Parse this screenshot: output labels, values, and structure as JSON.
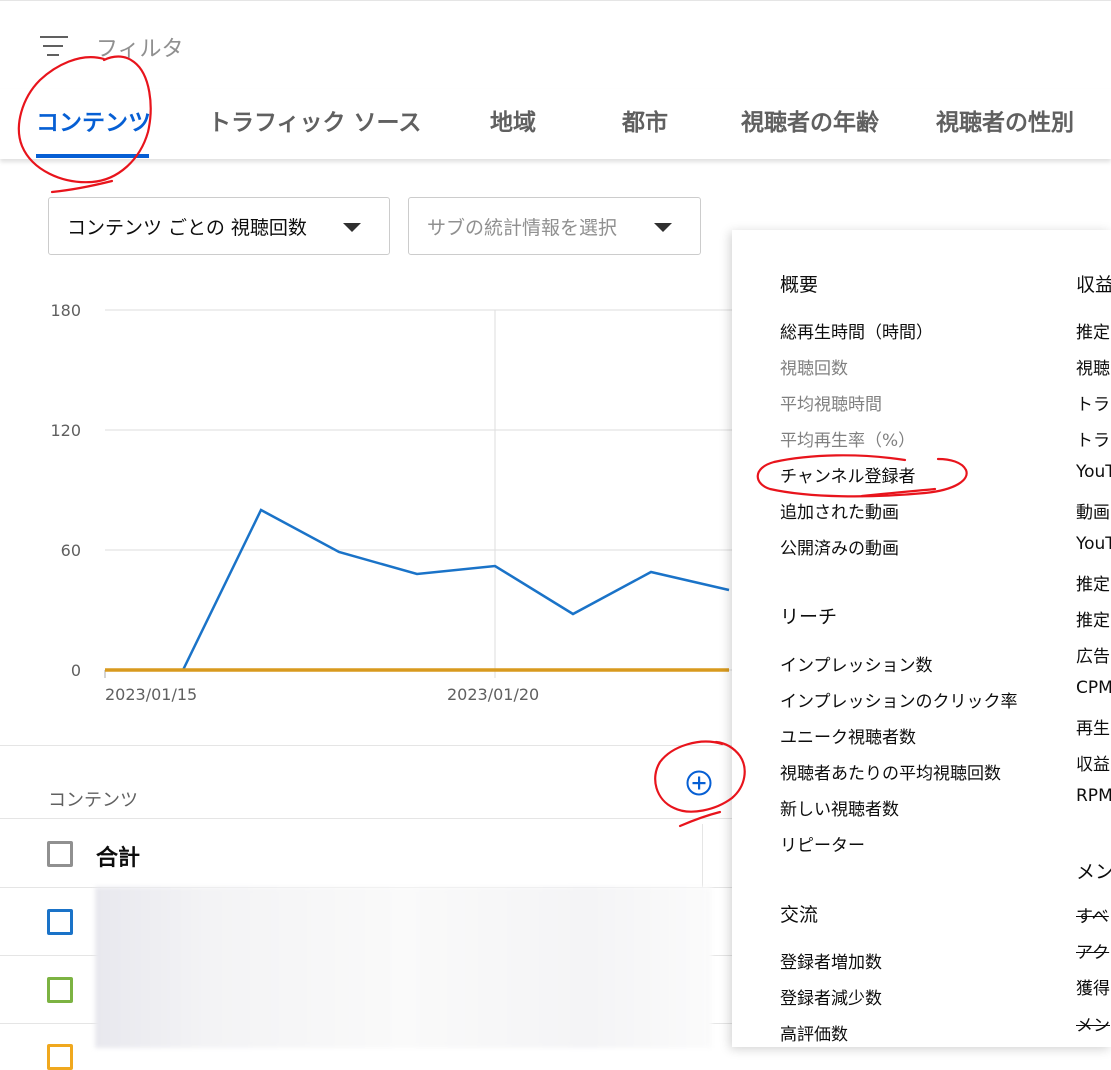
{
  "filter": {
    "label": "フィルタ",
    "icon": "filter-lines-icon"
  },
  "tabs": [
    {
      "label": "コンテンツ",
      "active": true
    },
    {
      "label": "トラフィック ソース"
    },
    {
      "label": "地域"
    },
    {
      "label": "都市"
    },
    {
      "label": "視聴者の年齢"
    },
    {
      "label": "視聴者の性別"
    }
  ],
  "dropdowns": {
    "metric": "コンテンツ ごとの 視聴回数",
    "sub_metric_placeholder": "サブの統計情報を選択"
  },
  "chart_data": {
    "type": "line",
    "y_ticks": [
      180,
      120,
      60,
      0
    ],
    "x_tick_labels": [
      "2023/01/15",
      "2023/01/20"
    ],
    "ylim": [
      0,
      180
    ],
    "grid": true,
    "x": [
      "2023/01/14",
      "2023/01/15",
      "2023/01/16",
      "2023/01/17",
      "2023/01/18",
      "2023/01/19",
      "2023/01/20",
      "2023/01/21",
      "2023/01/22",
      "2023/01/23"
    ],
    "series": [
      {
        "color": "#1a73c8",
        "values": [
          0,
          0,
          0,
          80,
          59,
          48,
          52,
          28,
          49,
          40
        ]
      },
      {
        "color": "#d89a1e",
        "values": [
          0,
          0,
          0,
          0,
          0,
          0,
          0,
          0,
          0,
          0
        ]
      }
    ]
  },
  "content_table": {
    "header": "コンテンツ",
    "add_column_icon": "add-circle-icon",
    "total_label": "合計",
    "row_colors": [
      "#1a73c8",
      "#7cb342",
      "#f0a81e"
    ]
  },
  "metric_menu": {
    "col1": [
      {
        "section": "概要",
        "items": [
          {
            "label": "総再生時間（時間）"
          },
          {
            "label": "視聴回数",
            "dim": true
          },
          {
            "label": "平均視聴時間",
            "dim": true
          },
          {
            "label": "平均再生率（%）",
            "dim": true
          },
          {
            "label": "チャンネル登録者"
          },
          {
            "label": "追加された動画"
          },
          {
            "label": "公開済みの動画"
          }
        ]
      },
      {
        "section": "リーチ",
        "items": [
          {
            "label": "インプレッション数"
          },
          {
            "label": "インプレッションのクリック率"
          },
          {
            "label": "ユニーク視聴者数"
          },
          {
            "label": "視聴者あたりの平均視聴回数"
          },
          {
            "label": "新しい視聴者数"
          },
          {
            "label": "リピーター"
          }
        ]
      },
      {
        "section": "交流",
        "items": [
          {
            "label": "登録者増加数"
          },
          {
            "label": "登録者減少数"
          },
          {
            "label": "高評価数"
          }
        ]
      }
    ],
    "col2": [
      {
        "section": "収益",
        "items": [
          {
            "label": "推定"
          },
          {
            "label": "視聴"
          },
          {
            "label": "トラ"
          },
          {
            "label": "トラ"
          },
          {
            "label": "YouT"
          },
          {
            "label": "動画"
          },
          {
            "label": "YouT"
          },
          {
            "label": "推定"
          },
          {
            "label": "推定"
          },
          {
            "label": "広告"
          },
          {
            "label": "CPM"
          },
          {
            "label": "再生"
          },
          {
            "label": "収益"
          },
          {
            "label": "RPM"
          }
        ]
      },
      {
        "section": "メン",
        "items": [
          {
            "label": "すべ",
            "strike": true
          },
          {
            "label": "アク",
            "strike": true
          },
          {
            "label": "獲得"
          },
          {
            "label": "メン",
            "strike": true
          }
        ]
      }
    ]
  }
}
